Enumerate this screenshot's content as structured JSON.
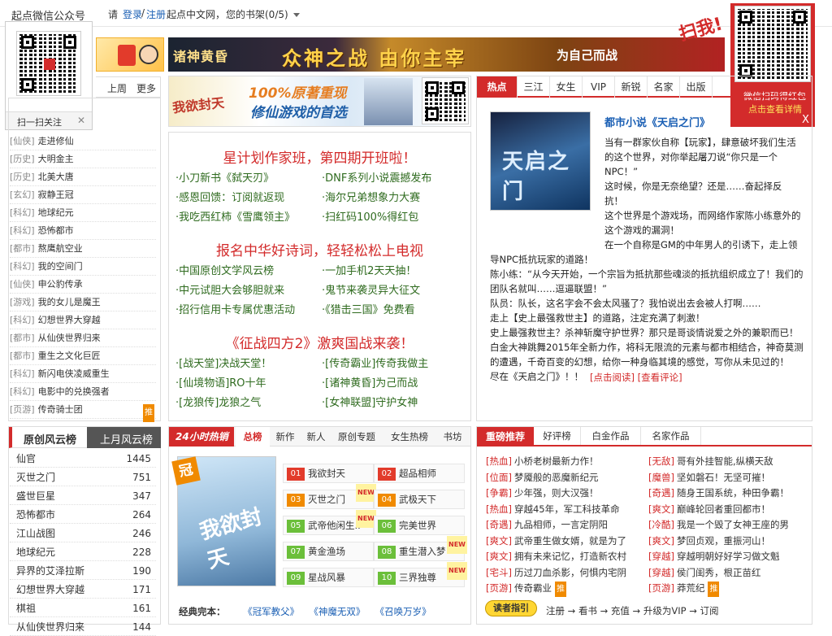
{
  "topbar": {
    "wechat_title": "起点微信公众号",
    "please": "请",
    "login": "登录",
    "slash": "/",
    "register": "注册",
    "site": "起点中文网，",
    "shelf": "您的书架(0/5)"
  },
  "qr_left": {
    "scan_label": "扫一扫关注",
    "close": "✕"
  },
  "qr_right": {
    "grab": "扫我!",
    "line1": "微信扫码得红包",
    "line2": "点击查看详情",
    "close": "X"
  },
  "banner1": {
    "game": "诸神黄昏",
    "slogan": "众神之战 由你主宰",
    "cta": "为自己而战"
  },
  "banner2": {
    "game": "我欲封天",
    "slogan_1": "100%原著重现",
    "slogan_2": "修仙游戏的首选"
  },
  "left_tabs": {
    "week": "上周",
    "more": "更多"
  },
  "left_list": [
    {
      "cat": "[仙侠]",
      "name": "走进修仙"
    },
    {
      "cat": "[历史]",
      "name": "大明金主"
    },
    {
      "cat": "[历史]",
      "name": "北美大唐"
    },
    {
      "cat": "[玄幻]",
      "name": "寂静王冠"
    },
    {
      "cat": "[科幻]",
      "name": "地球纪元"
    },
    {
      "cat": "[科幻]",
      "name": "恐怖都市"
    },
    {
      "cat": "[都市]",
      "name": "熬鹰航空业"
    },
    {
      "cat": "[科幻]",
      "name": "我的空间门"
    },
    {
      "cat": "[仙侠]",
      "name": "申公豹传承"
    },
    {
      "cat": "[游戏]",
      "name": "我的女儿是魔王"
    },
    {
      "cat": "[科幻]",
      "name": "幻想世界大穿越"
    },
    {
      "cat": "[都市]",
      "name": "从仙侠世界归来"
    },
    {
      "cat": "[都市]",
      "name": "重生之文化巨匠"
    },
    {
      "cat": "[科幻]",
      "name": "新闪电侠凌威重生"
    },
    {
      "cat": "[科幻]",
      "name": "电影中的兑换强者"
    },
    {
      "cat": "[页游]",
      "name": "传奇骑士团",
      "tag": "推"
    }
  ],
  "ranking": {
    "tab_active": "原创风云榜",
    "tab_other": "上月风云榜",
    "rows": [
      {
        "name": "仙官",
        "value": "1445"
      },
      {
        "name": "灭世之门",
        "value": "751"
      },
      {
        "name": "盛世巨星",
        "value": "347"
      },
      {
        "name": "恐怖都市",
        "value": "264"
      },
      {
        "name": "江山战图",
        "value": "246"
      },
      {
        "name": "地球纪元",
        "value": "228"
      },
      {
        "name": "异界的艾泽拉斯",
        "value": "190"
      },
      {
        "name": "幻想世界大穿越",
        "value": "171"
      },
      {
        "name": "棋祖",
        "value": "161"
      },
      {
        "name": "从仙侠世界归来",
        "value": "144"
      }
    ]
  },
  "middle": {
    "head1": "星计划作家班，第四期开班啦！",
    "links1": [
      "·小刀新书《弑天刃》",
      "·DNF系列小说震撼发布",
      "·感恩回馈：订阅就返现",
      "·海尔兄弟想象力大赛",
      "·我吃西红柿《雪鹰领主》",
      "·扫红码100%得红包"
    ],
    "head2": "报名中华好诗词，轻轻松松上电视",
    "links2": [
      "·中国原创文学风云榜",
      "·一加手机2天天抽！",
      "·中元试胆大会够胆就来",
      "·鬼节来袭灵异大征文",
      "·招行信用卡专属优惠活动",
      "·《猎击三国》免费看"
    ],
    "head3": "《征战四方2》激爽国战来袭！",
    "links3": [
      "·[战天堂]决战天堂！",
      "·[传奇霸业]传奇我做主",
      "·[仙境物语]RO十年",
      "·[诸神黄昏]为己而战",
      "·[龙狼传]龙狼之气",
      "·[女神联盟]守护女神"
    ]
  },
  "right_tabs": [
    "热点",
    "三江",
    "女生",
    "VIP",
    "新锐",
    "名家",
    "出版"
  ],
  "feature": {
    "cover_title": "天启之门",
    "headline": "都市小说《天启之门》",
    "lines": [
      "当有一群家伙自称【玩家】，肆意破坏我们生活",
      "的这个世界，对你举起屠刀说“你只是一个",
      "NPC！”",
      "这时候，你是无奈绝望？还是……奋起择反",
      "抗！",
      "这个世界是个游戏场，而网络作家陈小练意外的",
      "这个游戏的漏洞！",
      "在一个自称是GM的中年男人的引诱下，走上领",
      "导NPC抵抗玩家的道路！",
      "陈小练：“从今天开始，一个宗旨为抵抗那些魂淡的抵抗组织成立了！我们的",
      "团队名就叫……逗逼联盟！”",
      "队员：队长，这名字会不会太风骚了？我怕说出去会被人打啊……",
      "走上【史上最强救世主】的道路，注定充满了刺激！",
      "史上最强救世主？杀神斩魔守护世界？那只是哥谈情说爱之外的兼职而已！",
      "白金大神跳舞2015年全新力作，将科无限流的元素与都市相结合，神奇莫测",
      "的遭遇，千奇百变的幻想，给你一种身临其境的感觉，写你从未见过的！",
      "尽在《天启之门》！！"
    ],
    "read_link": "[点击阅读]",
    "review_link": "[查看评论]"
  },
  "hot24": {
    "title": "24小时热销",
    "tabs": [
      "总榜",
      "新作",
      "新人",
      "原创专题",
      "女生热榜",
      "书坊"
    ],
    "crown": "冠",
    "cover": "我欲封天",
    "items": [
      {
        "no": "01",
        "name": "我欲封天"
      },
      {
        "no": "02",
        "name": "超品相师"
      },
      {
        "no": "03",
        "name": "灭世之门",
        "new": "NEW"
      },
      {
        "no": "04",
        "name": "武极天下"
      },
      {
        "no": "05",
        "name": "武帝他闲生..",
        "new": "NEW"
      },
      {
        "no": "06",
        "name": "完美世界"
      },
      {
        "no": "07",
        "name": "黄金渔场"
      },
      {
        "no": "08",
        "name": "重生潜入梦",
        "new": "NEW"
      },
      {
        "no": "09",
        "name": "星战风暴"
      },
      {
        "no": "10",
        "name": "三界独尊",
        "new": "NEW"
      }
    ],
    "classic_label": "经典完本：",
    "classics": [
      "《冠军教父》",
      "《神魔无双》",
      "《召唤万岁》"
    ]
  },
  "recommend": {
    "title": "重磅推荐",
    "tabs": [
      "好评榜",
      "白金作品",
      "名家作品"
    ],
    "left": [
      {
        "cat": "[热血]",
        "name": "小桥老树最新力作！"
      },
      {
        "cat": "[位面]",
        "name": "梦魇般的恶魔新纪元"
      },
      {
        "cat": "[争霸]",
        "name": "少年强，则大汉强！"
      },
      {
        "cat": "[热血]",
        "name": "穿越45年，军工科技革命"
      },
      {
        "cat": "[奇遇]",
        "name": "九品相师，一言定阴阳"
      },
      {
        "cat": "[爽文]",
        "name": "武帝重生做女婿，就是为了"
      },
      {
        "cat": "[爽文]",
        "name": "拥有未来记忆，打造新农村"
      },
      {
        "cat": "[宅斗]",
        "name": "历过刀血杀影，何惧内宅阴"
      },
      {
        "cat": "[页游]",
        "name": "传奇霸业",
        "tag": "推"
      }
    ],
    "right": [
      {
        "cat": "[无敌]",
        "name": "哥有外挂智能,纵横天敌"
      },
      {
        "cat": "[魔兽]",
        "name": "坚如磐石！无坚可摧！"
      },
      {
        "cat": "[奇遇]",
        "name": "随身王国系统，种田争霸！"
      },
      {
        "cat": "[爽文]",
        "name": "巅峰轮回者重回都市！"
      },
      {
        "cat": "[冷酷]",
        "name": "我是一个毁了女神王座的男"
      },
      {
        "cat": "[爽文]",
        "name": "梦回贞观，重振河山！"
      },
      {
        "cat": "[穿越]",
        "name": "穿越明朝好好学习做文魁"
      },
      {
        "cat": "[穿越]",
        "name": "侯门闺秀，根正苗红"
      },
      {
        "cat": "[页游]",
        "name": "莽荒纪",
        "tag": "推"
      }
    ]
  },
  "guide": {
    "label": "读者指引",
    "steps": "注册 → 看书 → 充值 → 升级为VIP → 订阅"
  },
  "colors": {
    "accent": "#d32b2b",
    "green_link": "#2f6b1f",
    "orange": "#f08a00"
  }
}
